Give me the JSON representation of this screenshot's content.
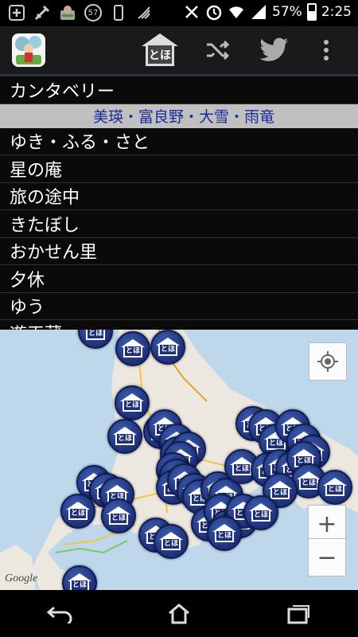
{
  "status_bar": {
    "badge": "57",
    "battery": "57%",
    "battery_level": 0.57,
    "time": "2:25",
    "icons": [
      "add-icon",
      "settings-icon",
      "robot-icon",
      "badge-icon",
      "phone-icon",
      "nfc-icon",
      "no-signal-icon",
      "alarm-icon",
      "wifi-icon",
      "signal-icon",
      "battery-icon"
    ]
  },
  "action_bar": {
    "app_icon": "tabi-app-icon",
    "home_label": "とほ",
    "actions": [
      "home-icon",
      "shuffle-icon",
      "twitter-icon",
      "overflow-menu-icon"
    ]
  },
  "list": {
    "items": [
      {
        "label": "カンタベリー",
        "type": "item"
      },
      {
        "label": "美瑛・富良野・大雪・雨竜",
        "type": "header"
      },
      {
        "label": "ゆき・ふる・さと",
        "type": "item"
      },
      {
        "label": "星の庵",
        "type": "item"
      },
      {
        "label": "旅の途中",
        "type": "item"
      },
      {
        "label": "きたぼし",
        "type": "item"
      },
      {
        "label": "おかせん里",
        "type": "item"
      },
      {
        "label": "夕休",
        "type": "item"
      },
      {
        "label": "ゆう",
        "type": "item"
      },
      {
        "label": "遊天蔵",
        "type": "partial"
      }
    ]
  },
  "map": {
    "pin_label": "とほ",
    "attribution": "Google",
    "zoom_in": "+",
    "zoom_out": "−",
    "colors": {
      "water": "#bed7ea",
      "land": "#ece8df",
      "pin": "#1d2f78"
    }
  },
  "nav_bar": {
    "buttons": [
      "back-icon",
      "home-icon",
      "recent-apps-icon"
    ]
  }
}
